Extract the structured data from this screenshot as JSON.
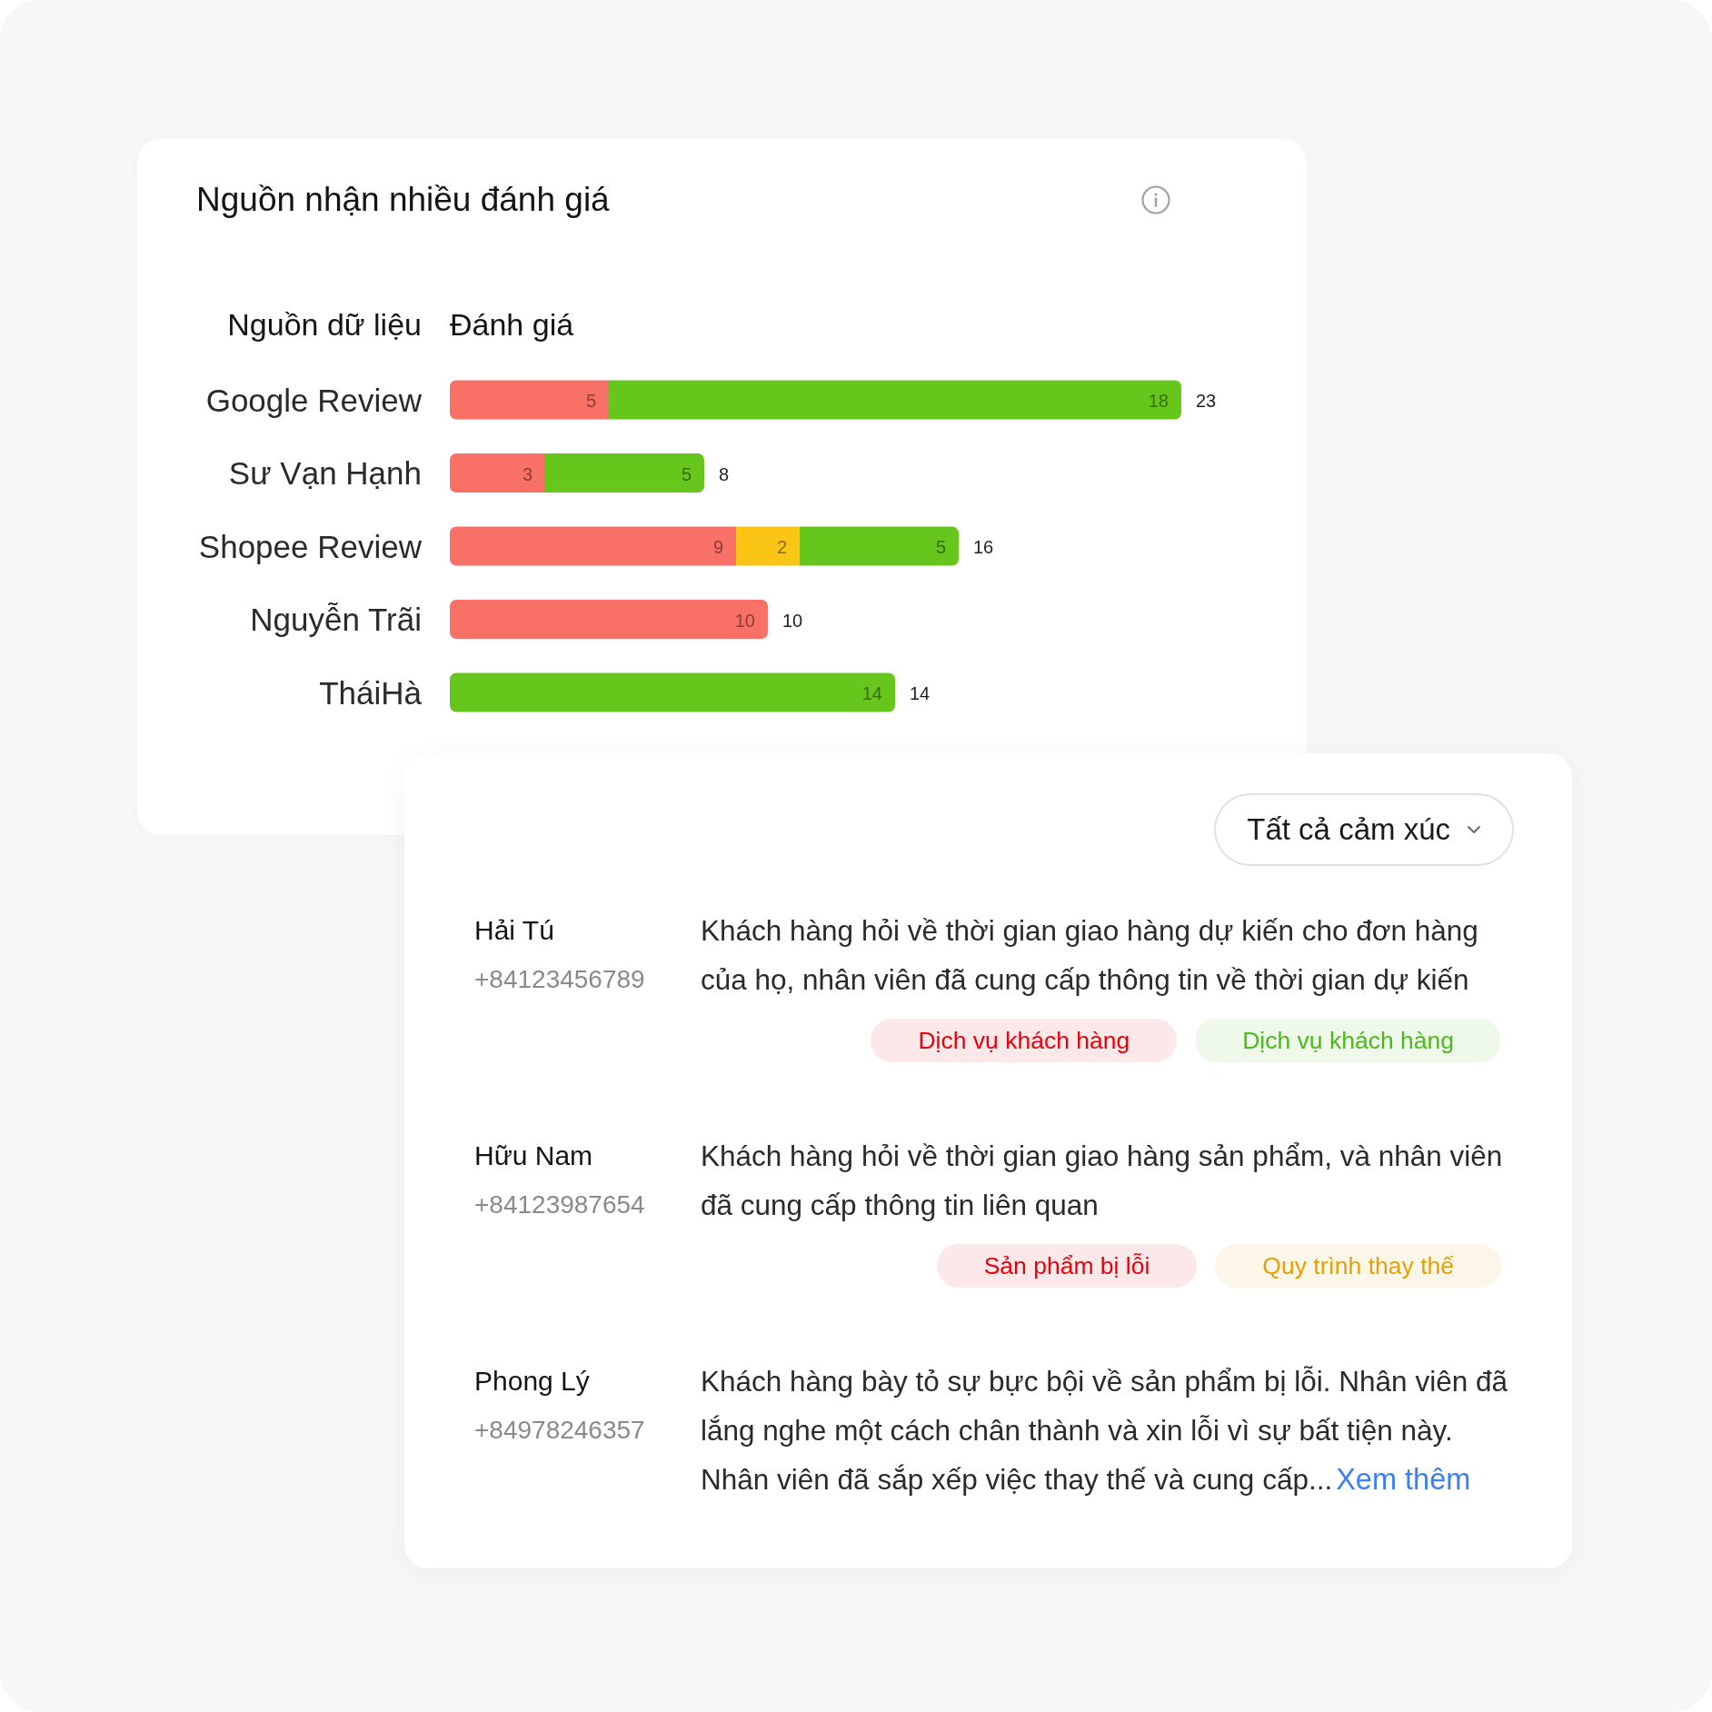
{
  "source_card": {
    "title": "Nguồn nhận nhiều đánh giá",
    "chart_data": {
      "type": "bar",
      "orientation": "horizontal",
      "stacked": true,
      "ylabel": "Nguồn dữ liệu",
      "xlabel": "Đánh giá",
      "categories": [
        "Google Review",
        "Sư Vạn Hạnh",
        "Shopee Review",
        "Nguyễn Trãi",
        "TháiHà"
      ],
      "series": [
        {
          "color": "#f97066",
          "values": [
            5,
            3,
            9,
            10,
            null
          ]
        },
        {
          "color": "#fac515",
          "values": [
            null,
            null,
            2,
            null,
            null
          ]
        },
        {
          "color": "#66c61c",
          "values": [
            18,
            5,
            5,
            null,
            14
          ]
        }
      ],
      "data_labels": true,
      "annotations": [
        "23",
        "8",
        "16",
        "10",
        "14"
      ]
    }
  },
  "reviews_card": {
    "filter": {
      "value": "Tất cả cảm xúc"
    },
    "reviews": [
      {
        "name": "Hải Tú",
        "phone": "+84123456789",
        "summary": "Khách hàng hỏi về thời gian giao hàng dự kiến cho đơn hàng của họ, nhân viên đã cung cấp thông tin về thời gian dự kiến",
        "tags": [
          {
            "label": "Dịch vụ khách hàng",
            "color": "#e8000b"
          },
          {
            "label": "Dịch vụ khách hàng",
            "color": "#4cb91a"
          }
        ]
      },
      {
        "name": "Hữu Nam",
        "phone": "+84123987654",
        "summary": "Khách hàng hỏi về thời gian giao hàng sản phẩm, và nhân viên đã cung cấp thông tin liên quan",
        "tags": [
          {
            "label": "Sản phẩm bị lỗi",
            "color": "#e8000b"
          },
          {
            "label": "Quy trình thay thế",
            "color": "#e3a008"
          }
        ]
      },
      {
        "name": "Phong Lý",
        "phone": "+84978246357",
        "summary": "Khách hàng bày tỏ sự bực bội về sản phẩm bị lỗi. Nhân viên đã lắng nghe một cách chân thành và xin lỗi vì sự bất tiện này. Nhân viên đã sắp xếp việc thay thế và cung cấp...",
        "more_link": "Xem thêm"
      }
    ]
  }
}
